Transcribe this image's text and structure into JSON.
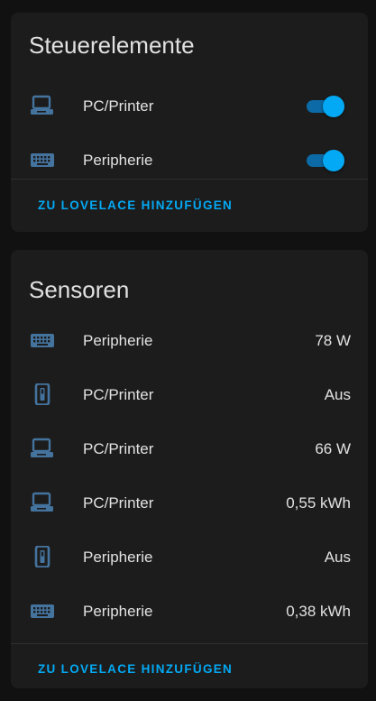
{
  "colors": {
    "background": "#111111",
    "card": "#1c1c1c",
    "accent": "#03a9f4",
    "icon": "#44739e",
    "text": "#e1e1e1"
  },
  "controls_card": {
    "title": "Steuerelemente",
    "items": [
      {
        "icon": "laptop-icon",
        "label": "PC/Printer",
        "state": "on"
      },
      {
        "icon": "keyboard-icon",
        "label": "Peripherie",
        "state": "on"
      }
    ],
    "action_label": "ZU LOVELACE HINZUFÜGEN"
  },
  "sensors_card": {
    "title": "Sensoren",
    "items": [
      {
        "icon": "keyboard-icon",
        "label": "Peripherie",
        "value": "78 W"
      },
      {
        "icon": "power-socket-icon",
        "label": "PC/Printer",
        "value": "Aus"
      },
      {
        "icon": "laptop-icon",
        "label": "PC/Printer",
        "value": "66 W"
      },
      {
        "icon": "laptop-icon",
        "label": "PC/Printer",
        "value": "0,55 kWh"
      },
      {
        "icon": "power-socket-icon",
        "label": "Peripherie",
        "value": "Aus"
      },
      {
        "icon": "keyboard-icon",
        "label": "Peripherie",
        "value": "0,38 kWh"
      }
    ],
    "action_label": "ZU LOVELACE HINZUFÜGEN"
  }
}
